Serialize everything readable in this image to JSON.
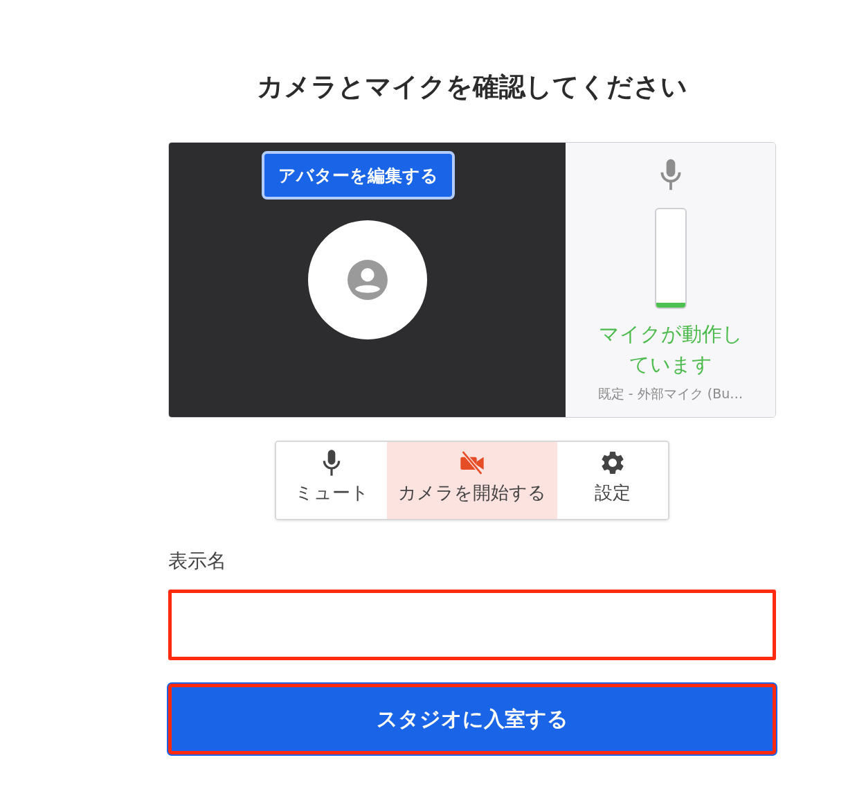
{
  "title": "カメラとマイクを確認してください",
  "preview": {
    "avatar_button": "アバターを編集する",
    "kind": "avatar"
  },
  "mic_panel": {
    "level": 0.05,
    "status": "マイクが動作しています",
    "device": "既定 - 外部マイク (Bu…"
  },
  "controls": [
    {
      "kind": "mic",
      "label": "ミュート",
      "alert": false
    },
    {
      "kind": "camera",
      "label": "カメラを開始する",
      "alert": true
    },
    {
      "kind": "settings",
      "label": "設定",
      "alert": false
    }
  ],
  "display_name": {
    "label": "表示名",
    "highlighted": true
  },
  "enter_button": {
    "label": "スタジオに入室する",
    "highlighted": true
  }
}
